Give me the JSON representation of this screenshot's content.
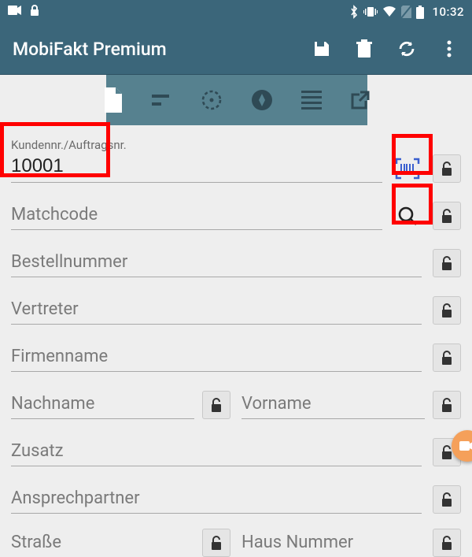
{
  "status": {
    "time": "10:32"
  },
  "app": {
    "title": "MobiFakt Premium"
  },
  "fields": {
    "kundennr": {
      "label": "Kundennr./Auftragsnr.",
      "value": "10001"
    },
    "matchcode": {
      "placeholder": "Matchcode"
    },
    "bestellnummer": {
      "placeholder": "Bestellnummer"
    },
    "vertreter": {
      "placeholder": "Vertreter"
    },
    "firmenname": {
      "placeholder": "Firmenname"
    },
    "nachname": {
      "placeholder": "Nachname"
    },
    "vorname": {
      "placeholder": "Vorname"
    },
    "zusatz": {
      "placeholder": "Zusatz"
    },
    "ansprechpartner": {
      "placeholder": "Ansprechpartner"
    },
    "strasse": {
      "placeholder": "Straße"
    },
    "hausnummer": {
      "placeholder": "Haus Nummer"
    }
  }
}
